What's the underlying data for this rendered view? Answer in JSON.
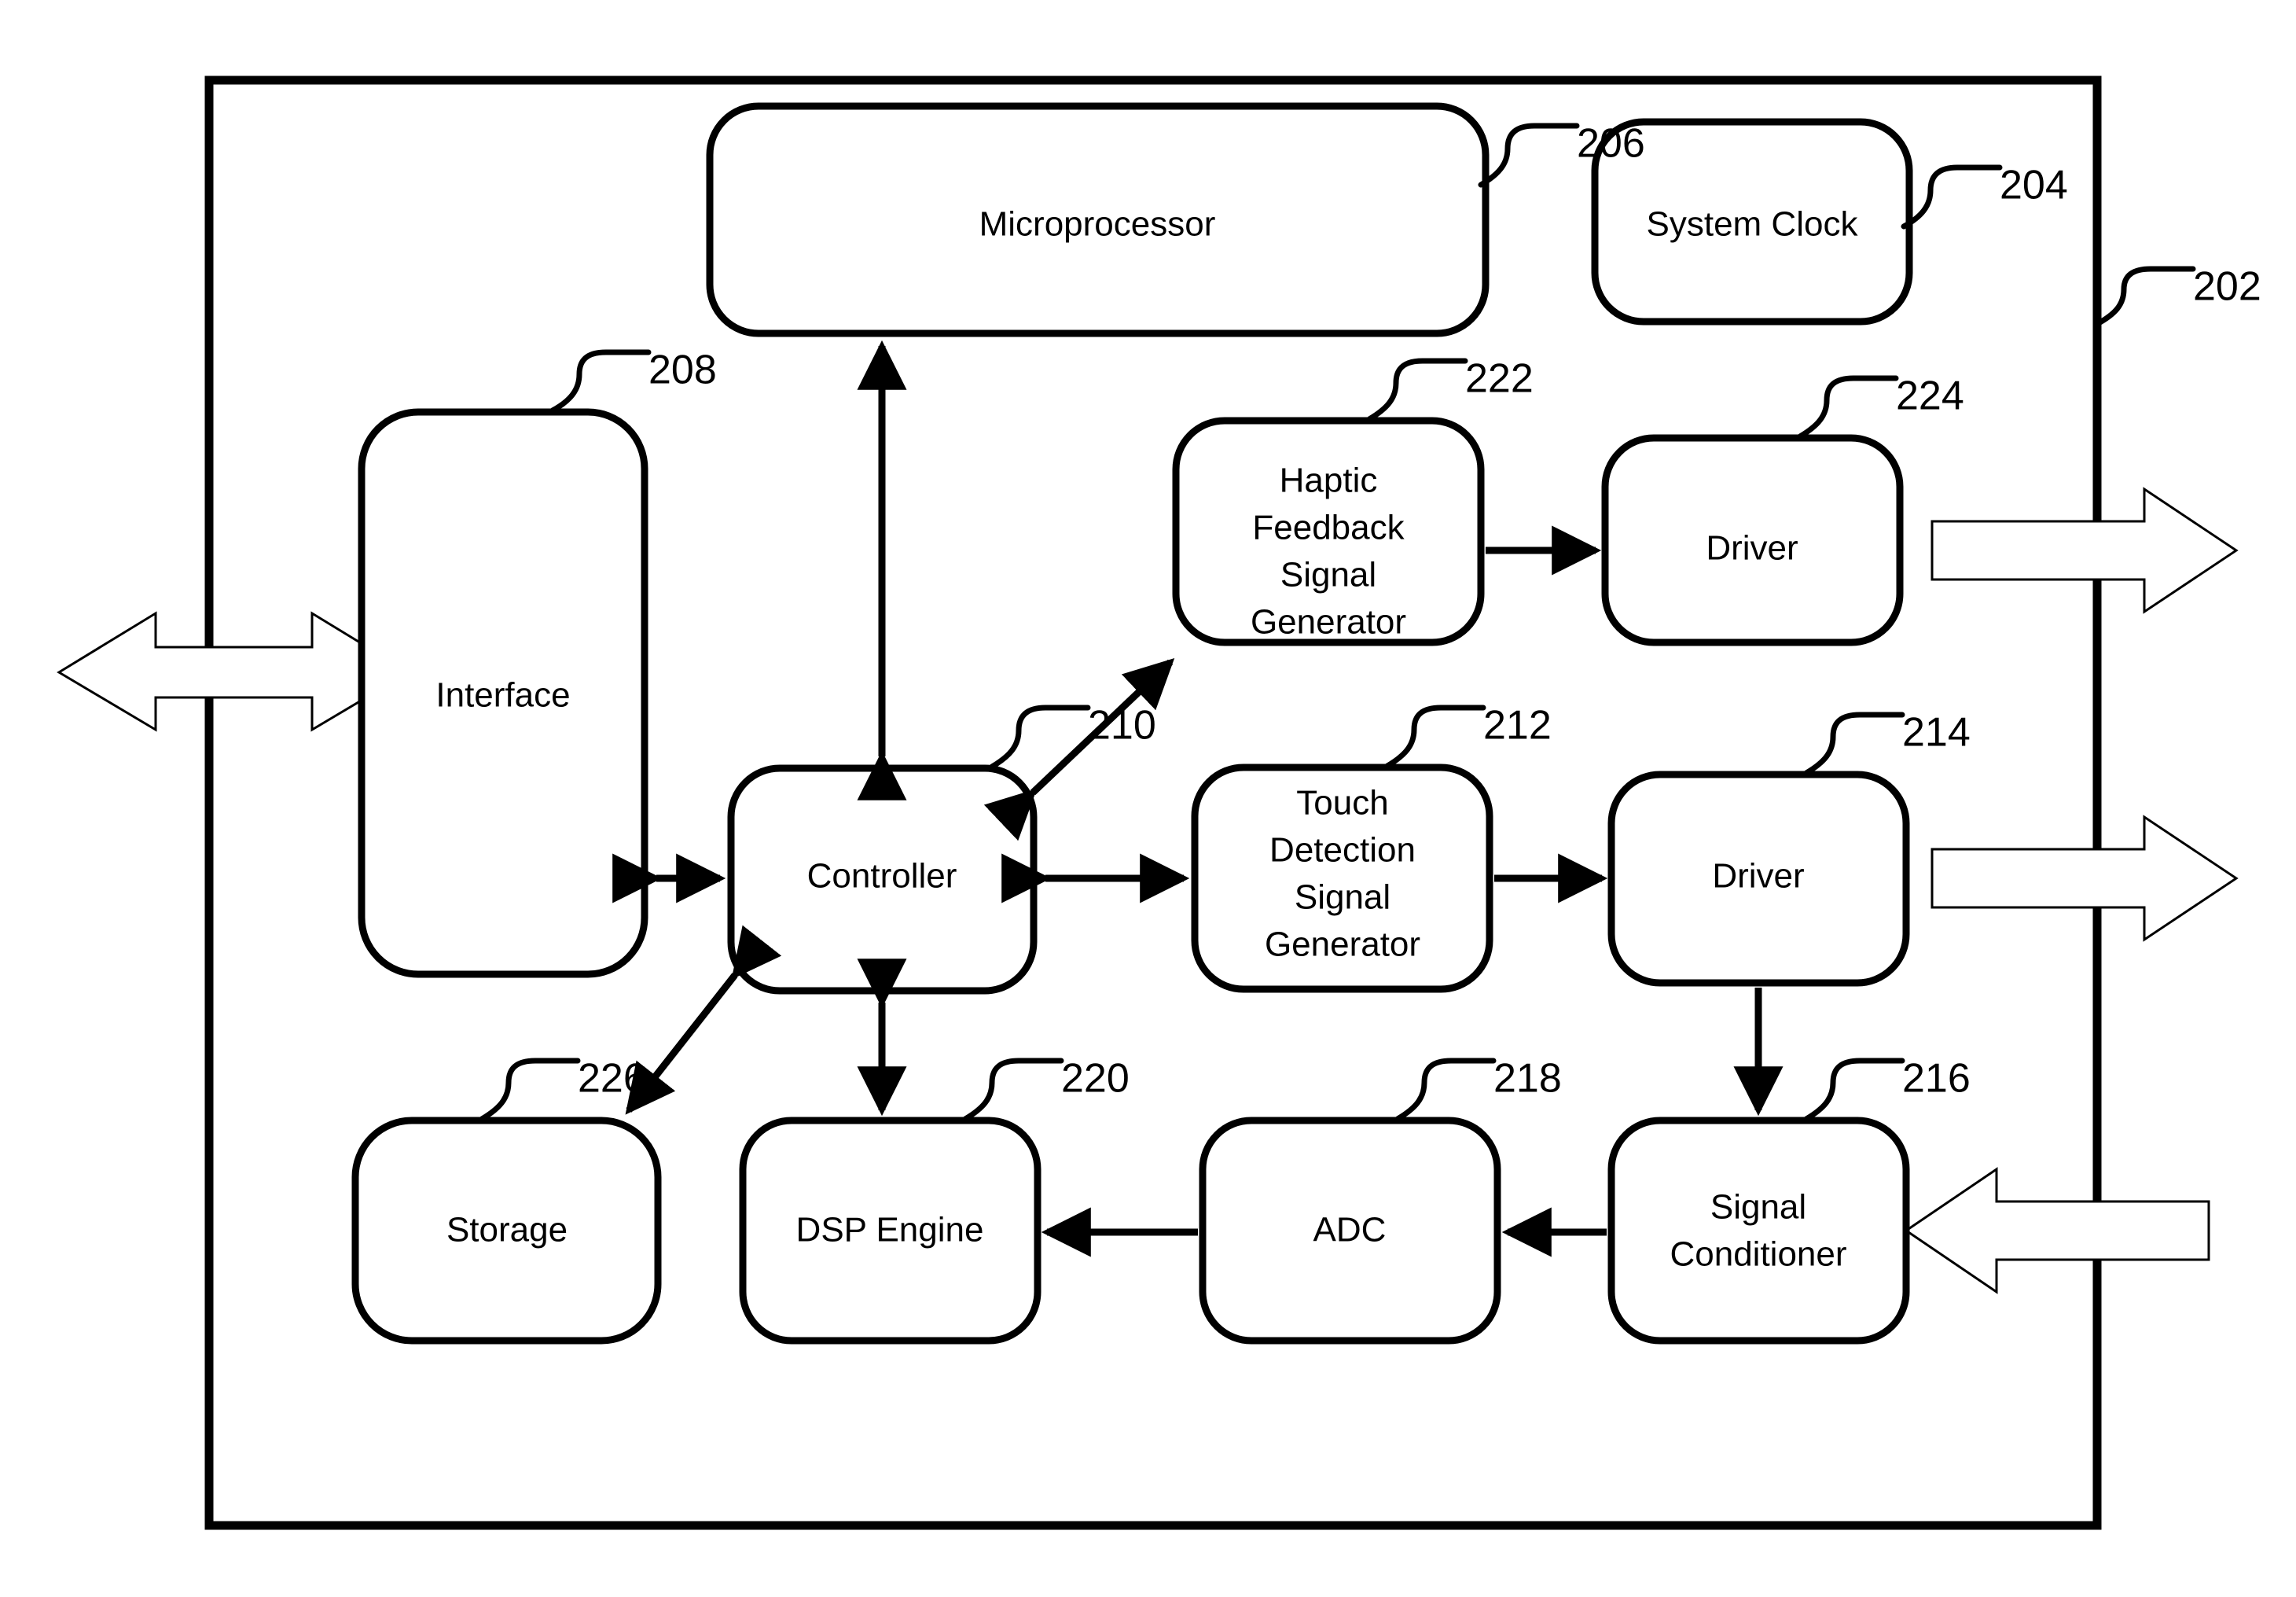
{
  "figure": {
    "type": "patent-block-diagram",
    "system_ref": "202",
    "background_color": "#ffffff",
    "line_color": "#000000"
  },
  "blocks": [
    {
      "id": "microprocessor",
      "label": "Microprocessor",
      "ref": "206",
      "lines": [
        "Microprocessor"
      ]
    },
    {
      "id": "system-clock",
      "label": "System Clock",
      "ref": "204",
      "lines": [
        "System Clock"
      ]
    },
    {
      "id": "interface",
      "label": "Interface",
      "ref": "208",
      "lines": [
        "Interface"
      ]
    },
    {
      "id": "controller",
      "label": "Controller",
      "ref": "210",
      "lines": [
        "Controller"
      ]
    },
    {
      "id": "haptic-feedback-signal-generator",
      "label": "Haptic Feedback Signal Generator",
      "ref": "222",
      "lines": [
        "Haptic",
        "Feedback",
        "Signal",
        "Generator"
      ]
    },
    {
      "id": "haptic-driver",
      "label": "Driver",
      "ref": "224",
      "lines": [
        "Driver"
      ]
    },
    {
      "id": "touch-detection-signal-generator",
      "label": "Touch Detection Signal Generator",
      "ref": "212",
      "lines": [
        "Touch",
        "Detection",
        "Signal",
        "Generator"
      ]
    },
    {
      "id": "touch-driver",
      "label": "Driver",
      "ref": "214",
      "lines": [
        "Driver"
      ]
    },
    {
      "id": "signal-conditioner",
      "label": "Signal Conditioner",
      "ref": "216",
      "lines": [
        "Signal",
        "Conditioner"
      ]
    },
    {
      "id": "adc",
      "label": "ADC",
      "ref": "218",
      "lines": [
        "ADC"
      ]
    },
    {
      "id": "dsp-engine",
      "label": "DSP Engine",
      "ref": "220",
      "lines": [
        "DSP Engine"
      ]
    },
    {
      "id": "storage",
      "label": "Storage",
      "ref": "226",
      "lines": [
        "Storage"
      ]
    }
  ],
  "labels": {
    "microprocessor": "Microprocessor",
    "system_clock": "System Clock",
    "interface": "Interface",
    "controller": "Controller",
    "haptic_l1": "Haptic",
    "haptic_l2": "Feedback",
    "haptic_l3": "Signal",
    "haptic_l4": "Generator",
    "haptic_driver": "Driver",
    "touch_l1": "Touch",
    "touch_l2": "Detection",
    "touch_l3": "Signal",
    "touch_l4": "Generator",
    "touch_driver": "Driver",
    "signal_cond_l1": "Signal",
    "signal_cond_l2": "Conditioner",
    "adc": "ADC",
    "dsp_engine": "DSP Engine",
    "storage": "Storage"
  },
  "refs": {
    "system": "202",
    "system_clock": "204",
    "microprocessor": "206",
    "interface": "208",
    "controller": "210",
    "touch_generator": "212",
    "touch_driver": "214",
    "signal_conditioner": "216",
    "adc": "218",
    "dsp_engine": "220",
    "haptic_generator": "222",
    "haptic_driver": "224",
    "storage": "226"
  },
  "connections": [
    {
      "from": "controller",
      "to": "microprocessor",
      "style": "double-arrow-vertical"
    },
    {
      "from": "interface",
      "to": "controller",
      "style": "double-arrow-horizontal"
    },
    {
      "from": "controller",
      "to": "haptic-feedback-signal-generator",
      "style": "double-arrow-diagonal"
    },
    {
      "from": "controller",
      "to": "touch-detection-signal-generator",
      "style": "double-arrow-horizontal"
    },
    {
      "from": "controller",
      "to": "dsp-engine",
      "style": "double-arrow-vertical"
    },
    {
      "from": "controller",
      "to": "storage",
      "style": "double-arrow-diagonal"
    },
    {
      "from": "haptic-feedback-signal-generator",
      "to": "haptic-driver",
      "style": "single-arrow-right"
    },
    {
      "from": "touch-detection-signal-generator",
      "to": "touch-driver",
      "style": "single-arrow-right"
    },
    {
      "from": "touch-driver",
      "to": "signal-conditioner",
      "style": "single-arrow-down"
    },
    {
      "from": "signal-conditioner",
      "to": "adc",
      "style": "single-arrow-left"
    },
    {
      "from": "adc",
      "to": "dsp-engine",
      "style": "single-arrow-left"
    }
  ],
  "external_ports": [
    {
      "id": "interface-io-port",
      "style": "hollow-double-arrow-horizontal",
      "side": "left"
    },
    {
      "id": "haptic-output-port",
      "style": "hollow-arrow-right",
      "side": "right"
    },
    {
      "id": "touch-output-port",
      "style": "hollow-arrow-right",
      "side": "right"
    },
    {
      "id": "sensor-input-port",
      "style": "hollow-arrow-left",
      "side": "right"
    }
  ]
}
